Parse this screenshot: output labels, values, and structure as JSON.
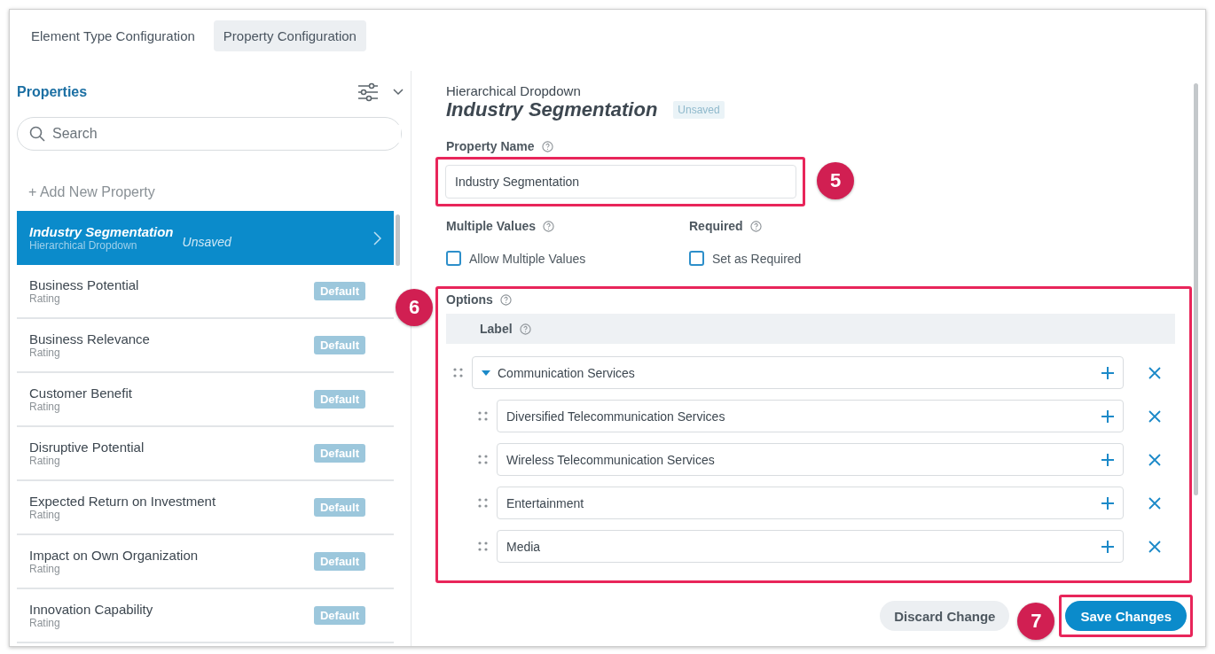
{
  "tabs": [
    {
      "label": "Element Type Configuration",
      "selected": false
    },
    {
      "label": "Property Configuration",
      "selected": true
    }
  ],
  "sidebar": {
    "title": "Properties",
    "search": {
      "placeholder": "Search"
    },
    "add_label": "+ Add New Property",
    "items": [
      {
        "name": "Industry Segmentation",
        "type": "Hierarchical Dropdown",
        "selected": true,
        "unsaved": true,
        "tag": "Unsaved"
      },
      {
        "name": "Business Potential",
        "type": "Rating",
        "selected": false,
        "unsaved": false,
        "tag": "Default"
      },
      {
        "name": "Business Relevance",
        "type": "Rating",
        "selected": false,
        "unsaved": false,
        "tag": "Default"
      },
      {
        "name": "Customer Benefit",
        "type": "Rating",
        "selected": false,
        "unsaved": false,
        "tag": "Default"
      },
      {
        "name": "Disruptive Potential",
        "type": "Rating",
        "selected": false,
        "unsaved": false,
        "tag": "Default"
      },
      {
        "name": "Expected Return on Investment",
        "type": "Rating",
        "selected": false,
        "unsaved": false,
        "tag": "Default"
      },
      {
        "name": "Impact on Own Organization",
        "type": "Rating",
        "selected": false,
        "unsaved": false,
        "tag": "Default"
      },
      {
        "name": "Innovation Capability",
        "type": "Rating",
        "selected": false,
        "unsaved": false,
        "tag": "Default"
      }
    ]
  },
  "detail": {
    "type": "Hierarchical Dropdown",
    "title": "Industry Segmentation",
    "status": "Unsaved",
    "property_name": {
      "label": "Property Name",
      "value": "Industry Segmentation",
      "callout": "5"
    },
    "multiple": {
      "label": "Multiple Values",
      "option": "Allow Multiple Values",
      "checked": false
    },
    "required": {
      "label": "Required",
      "option": "Set as Required",
      "checked": false
    },
    "options": {
      "label": "Options",
      "column": "Label",
      "callout": "6",
      "items": [
        {
          "label": "Communication Services",
          "expanded": true,
          "children": [
            {
              "label": "Diversified Telecommunication Services"
            },
            {
              "label": "Wireless Telecommunication Services"
            },
            {
              "label": "Entertainment"
            },
            {
              "label": "Media"
            }
          ]
        }
      ]
    },
    "discard_label": "Discard Change",
    "save_label": "Save Changes",
    "save_callout": "7"
  }
}
